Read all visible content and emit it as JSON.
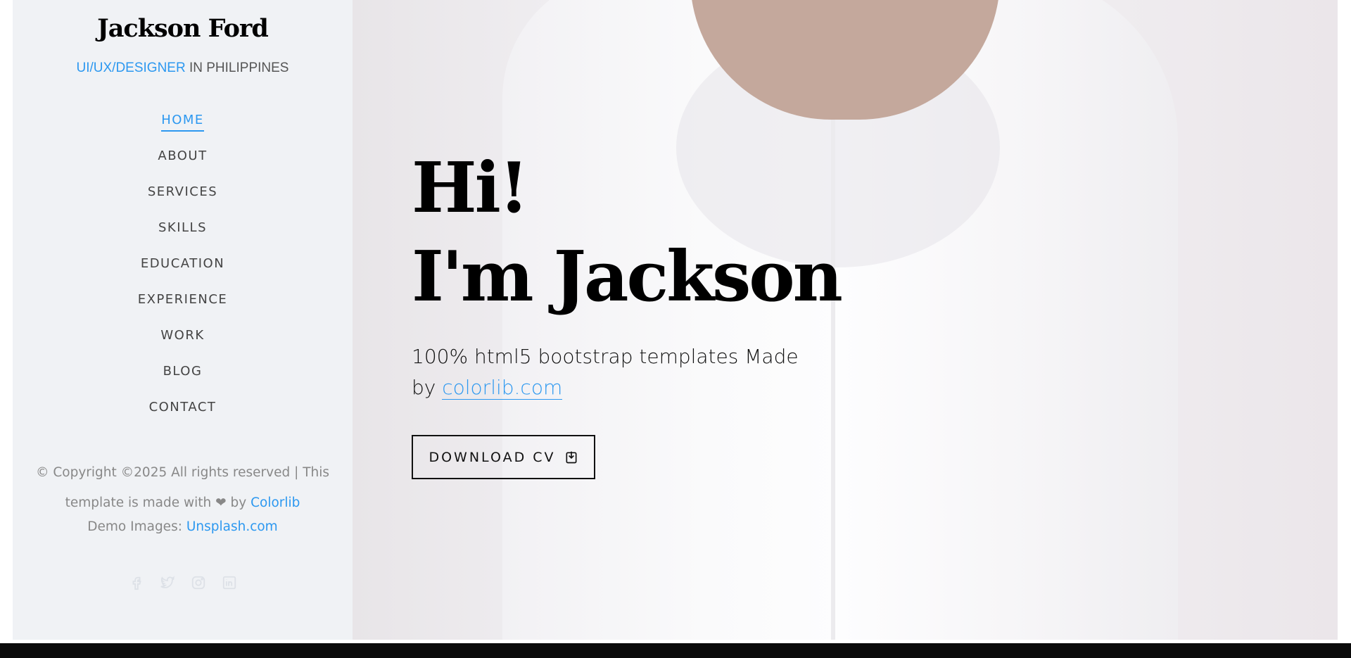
{
  "sidebar": {
    "brand": "Jackson Ford",
    "tagline": {
      "accent": "UI/UX/DESIGNER",
      "rest": " IN PHILIPPINES"
    },
    "nav": [
      {
        "label": "HOME",
        "active": true
      },
      {
        "label": "ABOUT"
      },
      {
        "label": "SERVICES"
      },
      {
        "label": "SKILLS"
      },
      {
        "label": "EDUCATION"
      },
      {
        "label": "EXPERIENCE"
      },
      {
        "label": "WORK"
      },
      {
        "label": "BLOG"
      },
      {
        "label": "CONTACT"
      }
    ],
    "copyright": {
      "text": "© Copyright ©2025 All rights reserved | This template is made with ❤ by ",
      "link": "Colorlib"
    },
    "demo": {
      "text": "Demo Images: ",
      "link": "Unsplash.com"
    },
    "social": [
      "facebook-icon",
      "twitter-icon",
      "instagram-icon",
      "linkedin-icon"
    ]
  },
  "hero": {
    "line1": "Hi!",
    "line2": "I'm Jackson",
    "subtext": "100% html5 bootstrap templates Made by ",
    "subtext_link": "colorlib.com",
    "button": "DOWNLOAD CV",
    "button_icon": "download-icon"
  },
  "colors": {
    "accent": "#2c98f0",
    "sidebar_bg": "#f0f2f5",
    "text": "#000000"
  }
}
